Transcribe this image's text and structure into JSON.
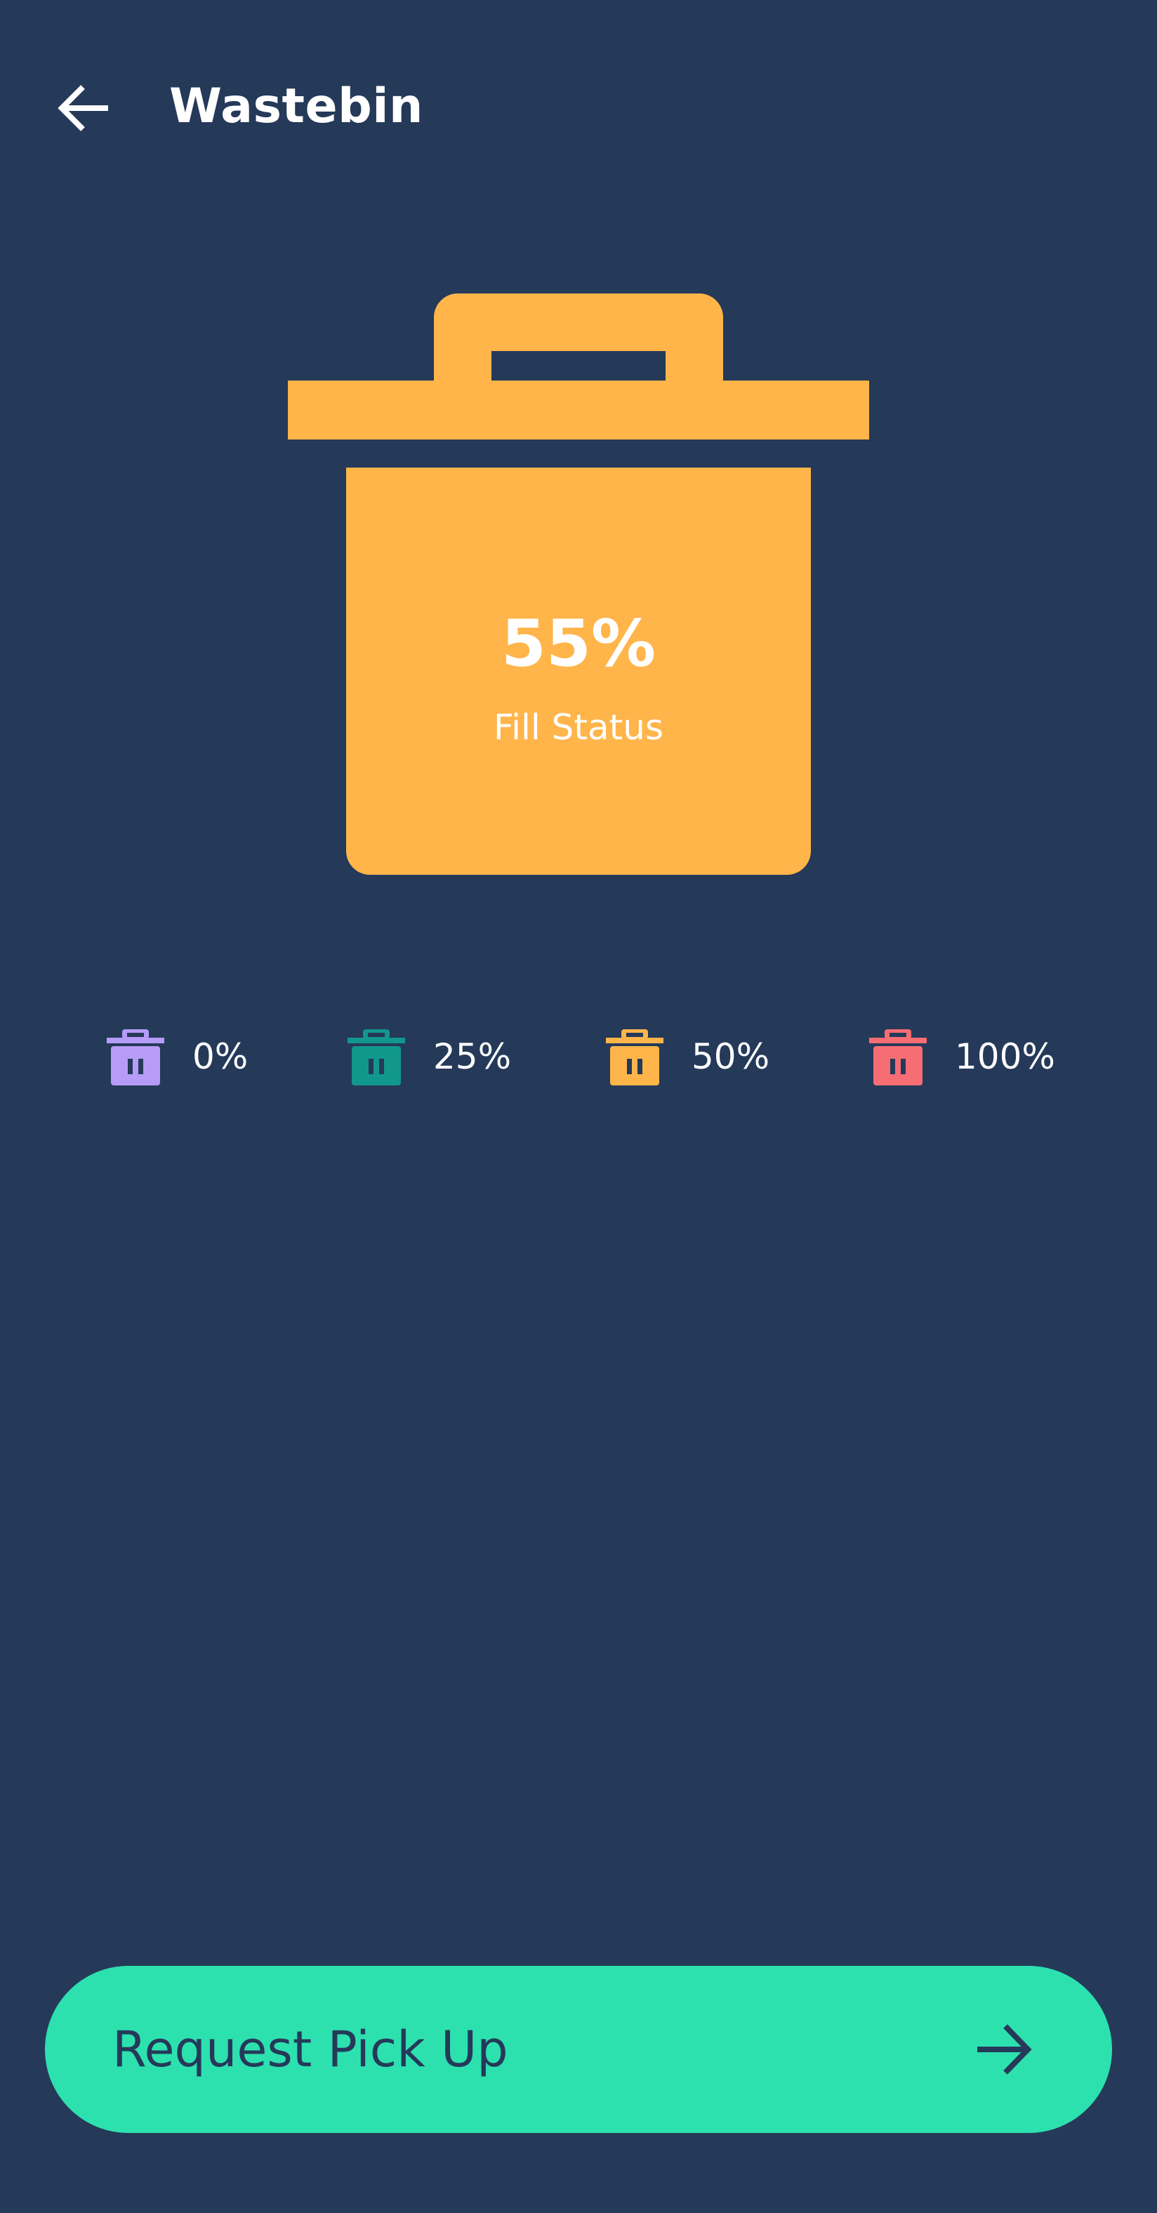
{
  "header": {
    "title": "Wastebin",
    "back_icon": "arrow-left-icon"
  },
  "bin": {
    "fill_percent": 55,
    "fill_value": "55%",
    "fill_label": "Fill Status",
    "color": "#FFB54A",
    "icon": "trash-bin-icon"
  },
  "legend": {
    "items": [
      {
        "label": "0%",
        "color": "#B69CF7",
        "icon": "trash-bin-icon"
      },
      {
        "label": "25%",
        "color": "#12978C",
        "icon": "trash-bin-icon"
      },
      {
        "label": "50%",
        "color": "#FFB54A",
        "icon": "trash-bin-icon"
      },
      {
        "label": "100%",
        "color": "#F76D74",
        "icon": "trash-bin-icon"
      }
    ]
  },
  "action": {
    "label": "Request Pick Up",
    "icon": "arrow-right-icon",
    "color": "#2DE1AF"
  },
  "colors": {
    "background": "#253959",
    "text_light": "#FFFFFF",
    "text_dark": "#253959"
  }
}
